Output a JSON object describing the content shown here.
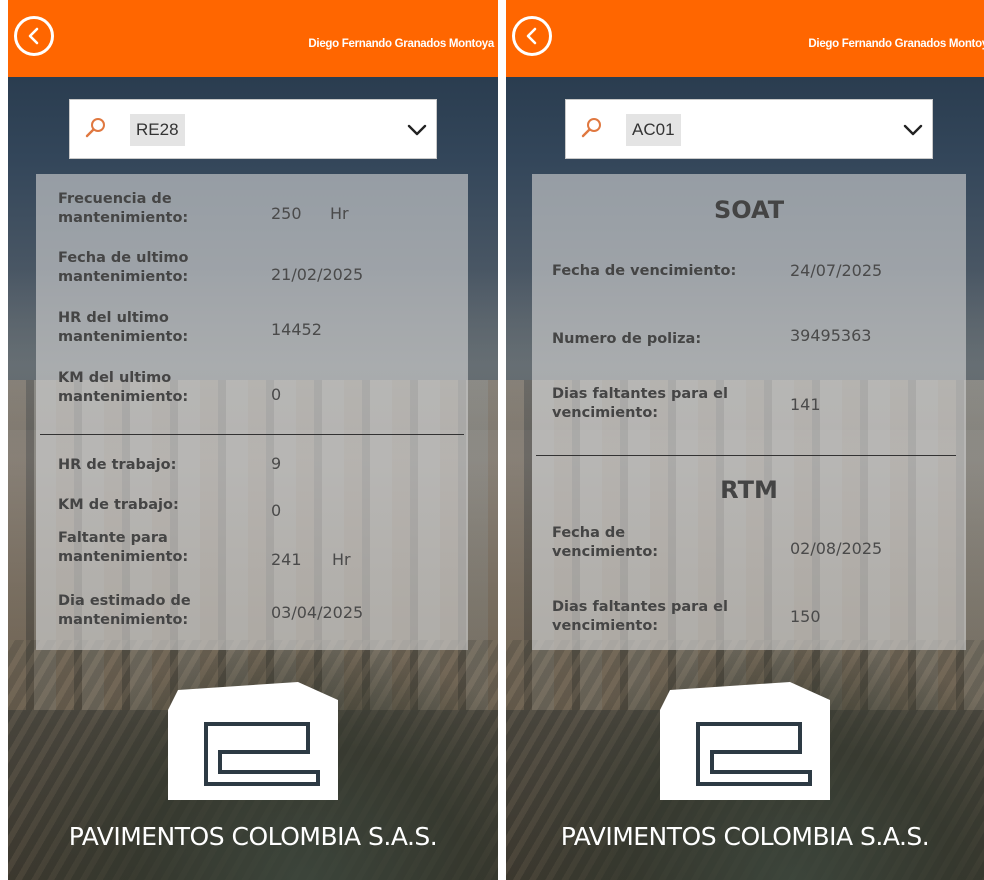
{
  "left": {
    "header": {
      "user_name": "Diego Fernando Granados Montoya"
    },
    "search": {
      "value": "RE28"
    },
    "details": {
      "frecuencia": {
        "label": "Frecuencia de mantenimiento:",
        "value": "250",
        "unit": "Hr"
      },
      "fecha_ultimo": {
        "label": "Fecha de ultimo mantenimiento:",
        "value": "21/02/2025"
      },
      "hr_ultimo": {
        "label": "HR del ultimo mantenimiento:",
        "value": "14452"
      },
      "km_ultimo": {
        "label": "KM del ultimo mantenimiento:",
        "value": "0"
      },
      "hr_trabajo": {
        "label": "HR de trabajo:",
        "value": "9"
      },
      "km_trabajo": {
        "label": "KM de trabajo:",
        "value": "0"
      },
      "faltante": {
        "label": "Faltante para mantenimiento:",
        "value": "241",
        "unit": "Hr"
      },
      "dia_estimado": {
        "label": "Dia estimado de mantenimiento:",
        "value": "03/04/2025"
      }
    },
    "company": "PAVIMENTOS COLOMBIA S.A.S."
  },
  "right": {
    "header": {
      "user_name": "Diego Fernando Granados Montoya"
    },
    "search": {
      "value": "AC01"
    },
    "soat": {
      "title": "SOAT",
      "fecha_vencimiento": {
        "label": "Fecha de vencimiento:",
        "value": "24/07/2025"
      },
      "numero_poliza": {
        "label": "Numero de poliza:",
        "value": "39495363"
      },
      "dias_faltantes": {
        "label": "Dias faltantes para el vencimiento:",
        "value": "141"
      }
    },
    "rtm": {
      "title": "RTM",
      "fecha_vencimiento": {
        "label": "Fecha de vencimiento:",
        "value": "02/08/2025"
      },
      "dias_faltantes": {
        "label": "Dias faltantes para el vencimiento:",
        "value": "150"
      }
    },
    "company": "PAVIMENTOS COLOMBIA S.A.S."
  },
  "icons": {
    "back": "back-arrow-circle-icon",
    "search": "search-icon",
    "dropdown": "chevron-down-icon"
  },
  "colors": {
    "header": "#ff6600",
    "search_icon": "#e07840"
  }
}
